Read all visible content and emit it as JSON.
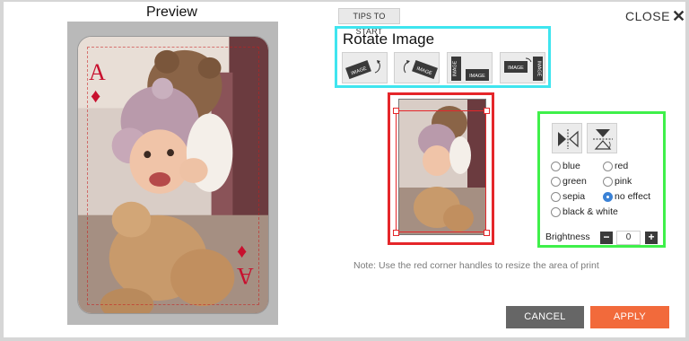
{
  "preview": {
    "title": "Preview"
  },
  "tips": {
    "label": "TIPS TO START"
  },
  "close": {
    "label": "CLOSE",
    "icon": "close-icon"
  },
  "rotate": {
    "title": "Rotate Image",
    "buttons": [
      {
        "name": "rotate-left-button",
        "text": "IMAGE"
      },
      {
        "name": "rotate-right-button",
        "text": "IMAGE"
      },
      {
        "name": "rotate-vertical-left-button",
        "text": "IMAGE"
      },
      {
        "name": "rotate-vertical-right-button",
        "text": "IMAGE"
      }
    ]
  },
  "card": {
    "rank": "A",
    "suit": "♦"
  },
  "note": "Note: Use the red corner handles to resize the area of print",
  "effects": {
    "options": [
      {
        "label": "blue",
        "selected": false
      },
      {
        "label": "red",
        "selected": false
      },
      {
        "label": "green",
        "selected": false
      },
      {
        "label": "pink",
        "selected": false
      },
      {
        "label": "sepia",
        "selected": false
      },
      {
        "label": "no effect",
        "selected": true
      },
      {
        "label": "black & white",
        "selected": false
      }
    ],
    "brightness_label": "Brightness",
    "brightness_value": "0",
    "minus": "−",
    "plus": "+"
  },
  "footer": {
    "cancel": "CANCEL",
    "apply": "APPLY"
  },
  "colors": {
    "accent": "#f26a3b",
    "cancel": "#666666",
    "rotate_border": "#3fe5ef",
    "crop_border": "#e5262a",
    "effects_border": "#3ff04a"
  }
}
